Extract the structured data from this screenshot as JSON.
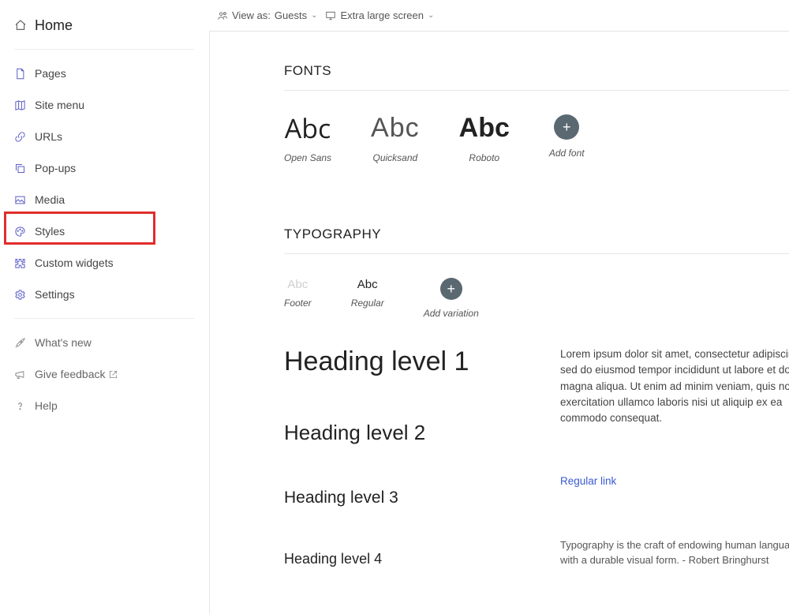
{
  "sidebar": {
    "home": "Home",
    "items": [
      {
        "label": "Pages"
      },
      {
        "label": "Site menu"
      },
      {
        "label": "URLs"
      },
      {
        "label": "Pop-ups"
      },
      {
        "label": "Media"
      },
      {
        "label": "Styles"
      },
      {
        "label": "Custom widgets"
      },
      {
        "label": "Settings"
      }
    ],
    "footer": [
      {
        "label": "What's new"
      },
      {
        "label": "Give feedback"
      },
      {
        "label": "Help"
      }
    ]
  },
  "topbar": {
    "view_as_label": "View as:",
    "view_as_value": "Guests",
    "screen_label": "Extra large screen"
  },
  "fonts": {
    "title": "FONTS",
    "sample": "Abc",
    "items": [
      {
        "name": "Open Sans"
      },
      {
        "name": "Quicksand"
      },
      {
        "name": "Roboto"
      }
    ],
    "add": "Add font"
  },
  "typography": {
    "title": "TYPOGRAPHY",
    "variations": [
      {
        "abc": "Abc",
        "name": "Footer",
        "muted": true
      },
      {
        "abc": "Abc",
        "name": "Regular",
        "muted": false
      }
    ],
    "add": "Add variation",
    "headings": {
      "h1": "Heading level 1",
      "h2": "Heading level 2",
      "h3": "Heading level 3",
      "h4": "Heading level 4"
    },
    "lorem": "Lorem ipsum dolor sit amet, consectetur adipiscing elit, sed do eiusmod tempor incididunt ut labore et dolore magna aliqua. Ut enim ad minim veniam, quis nostrud exercitation ullamco laboris nisi ut aliquip ex ea commodo consequat.",
    "link": "Regular link",
    "quote": "Typography is the craft of endowing human language with a durable visual form.\n- Robert Bringhurst"
  }
}
